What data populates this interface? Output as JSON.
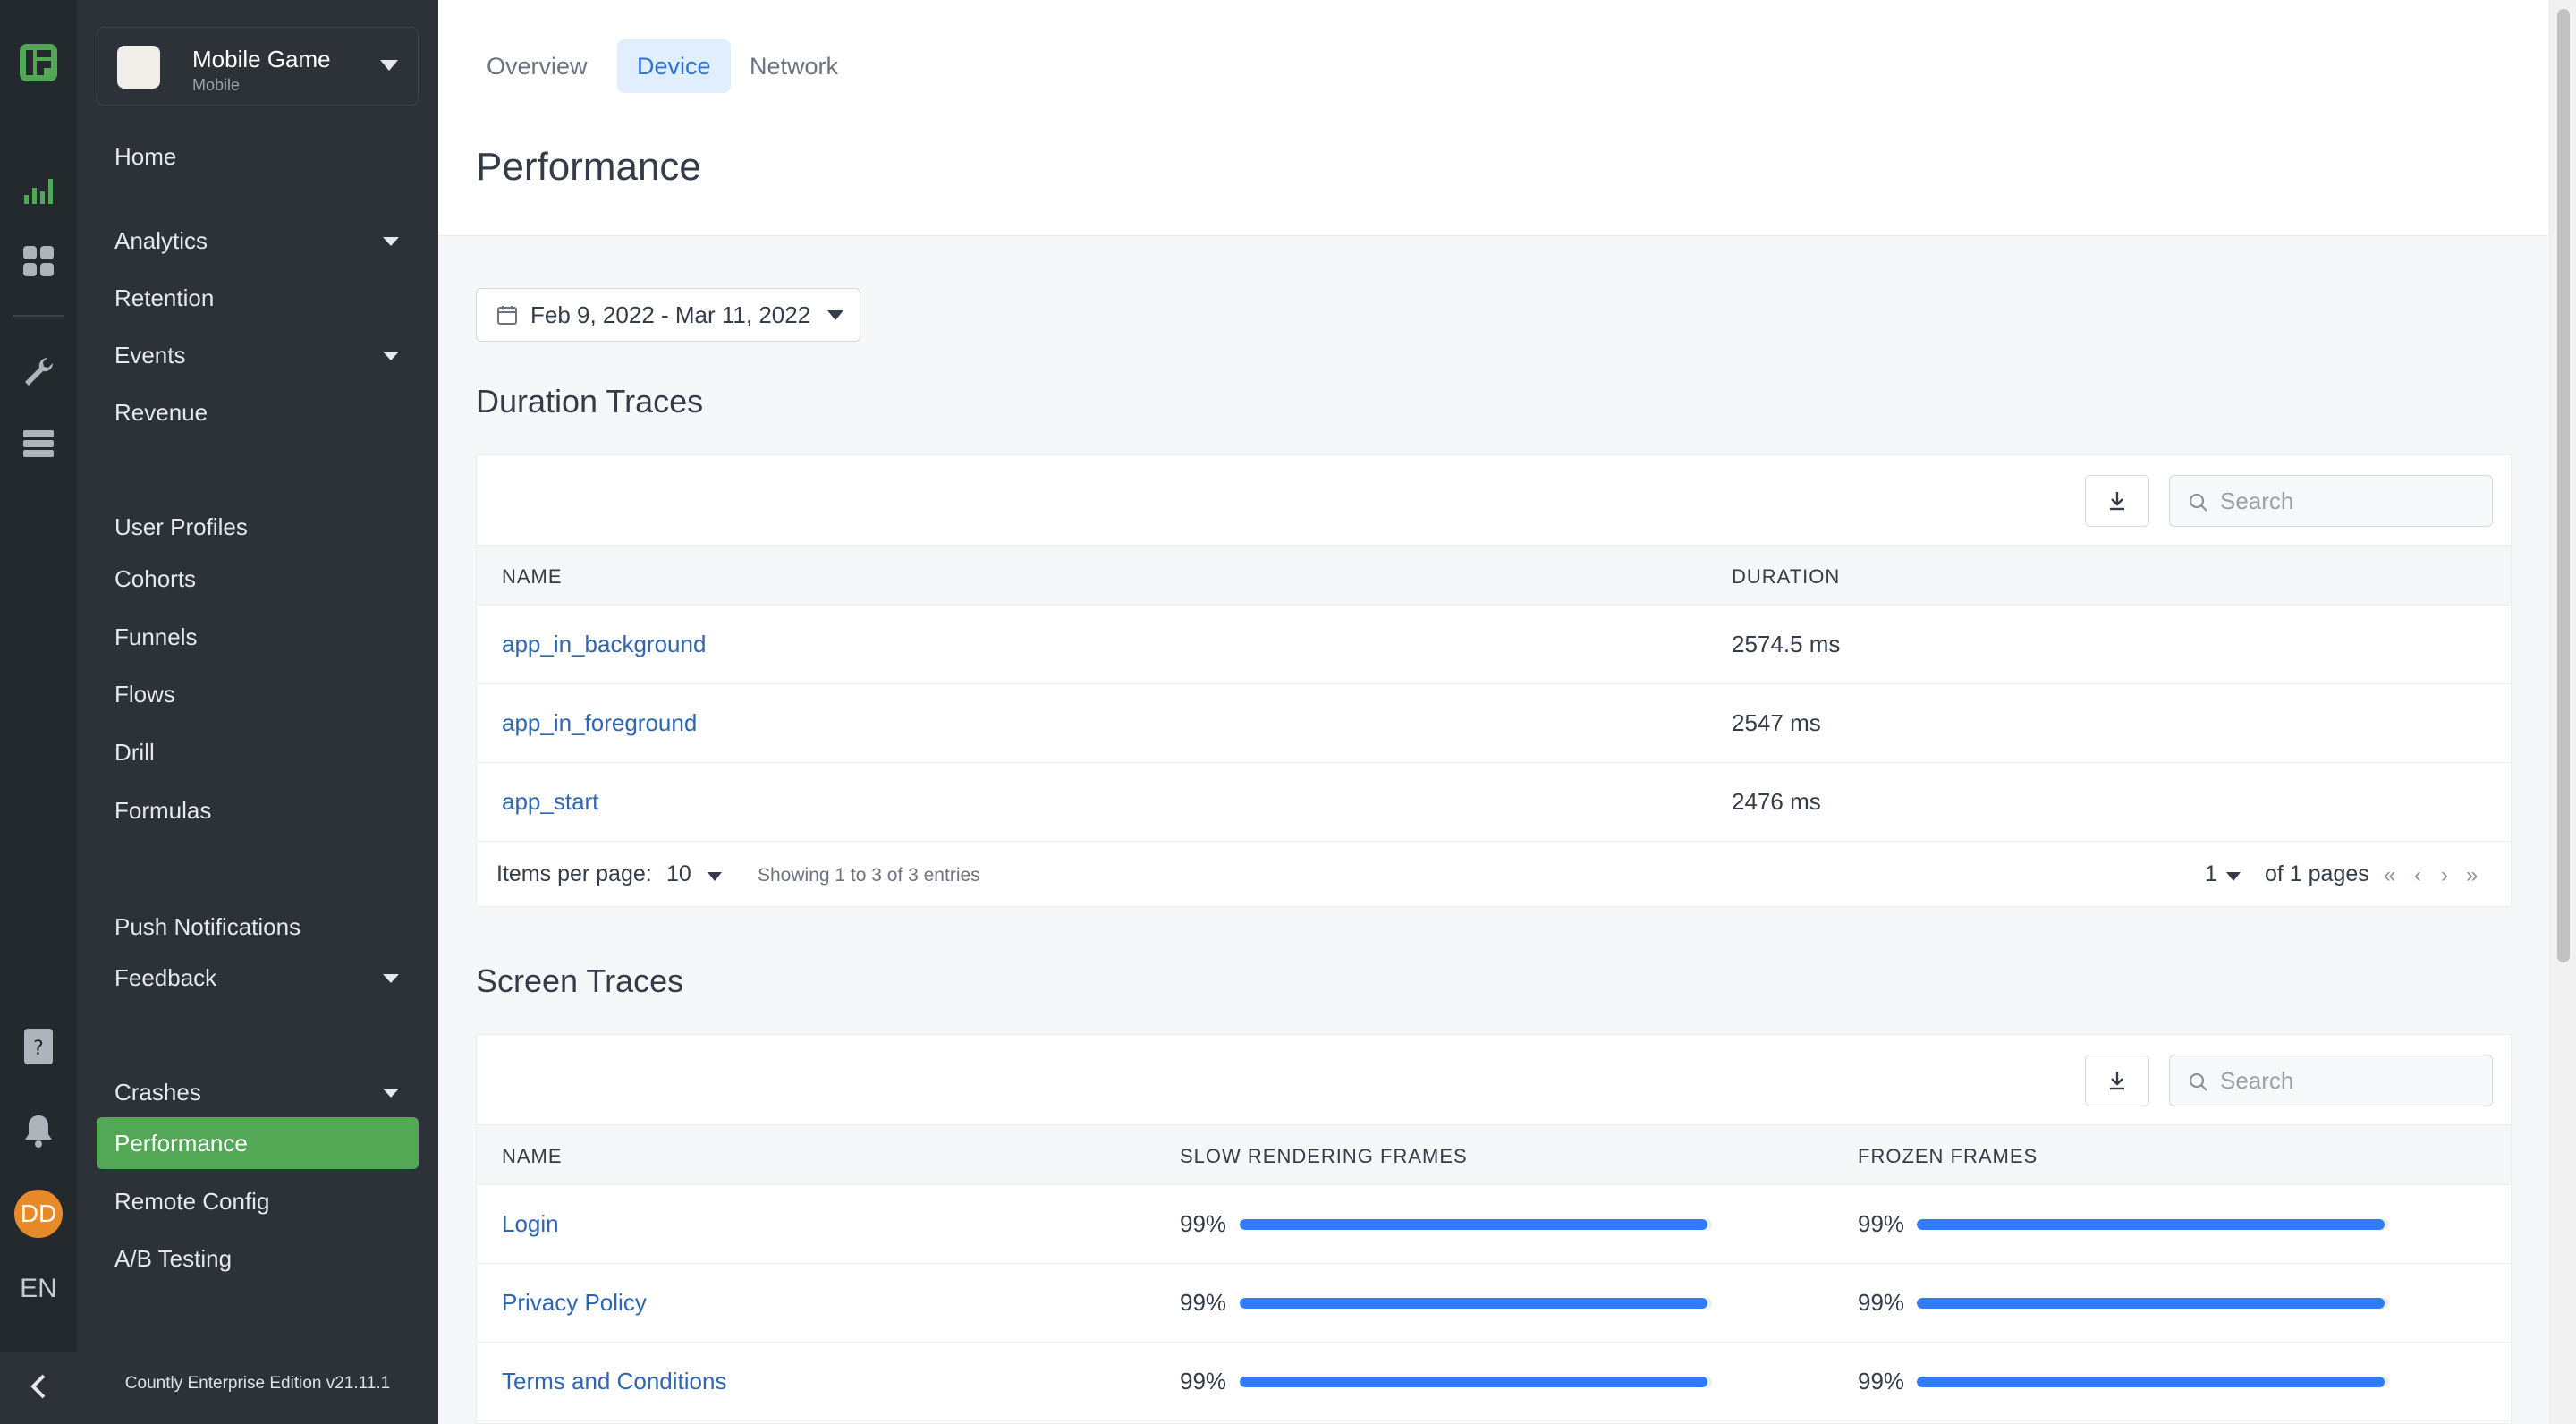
{
  "app": {
    "name": "Mobile Game",
    "type": "Mobile"
  },
  "user": {
    "initials": "DD",
    "language": "EN"
  },
  "sidebar": {
    "items": [
      {
        "label": "Home"
      },
      {
        "label": "Analytics"
      },
      {
        "label": "Retention"
      },
      {
        "label": "Events"
      },
      {
        "label": "Revenue"
      },
      {
        "label": "User Profiles"
      },
      {
        "label": "Cohorts"
      },
      {
        "label": "Funnels"
      },
      {
        "label": "Flows"
      },
      {
        "label": "Drill"
      },
      {
        "label": "Formulas"
      },
      {
        "label": "Push Notifications"
      },
      {
        "label": "Feedback"
      },
      {
        "label": "Crashes"
      },
      {
        "label": "Performance"
      },
      {
        "label": "Remote Config"
      },
      {
        "label": "A/B Testing"
      }
    ],
    "version": "Countly Enterprise Edition v21.11.1"
  },
  "tabs": [
    {
      "label": "Overview"
    },
    {
      "label": "Device"
    },
    {
      "label": "Network"
    }
  ],
  "page_title": "Performance",
  "date_range": "Feb 9, 2022 - Mar 11, 2022",
  "duration_traces": {
    "title": "Duration Traces",
    "search_placeholder": "Search",
    "columns": [
      "NAME",
      "DURATION"
    ],
    "rows": [
      {
        "name": "app_in_background",
        "duration": "2574.5 ms"
      },
      {
        "name": "app_in_foreground",
        "duration": "2547 ms"
      },
      {
        "name": "app_start",
        "duration": "2476 ms"
      }
    ],
    "items_per_page_label": "Items per page:",
    "items_per_page": "10",
    "showing": "Showing 1 to 3 of 3 entries",
    "page": "1",
    "page_total": "of 1 pages"
  },
  "screen_traces": {
    "title": "Screen Traces",
    "search_placeholder": "Search",
    "columns": [
      "NAME",
      "SLOW RENDERING FRAMES",
      "FROZEN FRAMES"
    ],
    "rows": [
      {
        "name": "Login",
        "slow": "99%",
        "slow_fraction": 0.99,
        "frozen": "99%",
        "frozen_fraction": 0.99
      },
      {
        "name": "Privacy Policy",
        "slow": "99%",
        "slow_fraction": 0.99,
        "frozen": "99%",
        "frozen_fraction": 0.99
      },
      {
        "name": "Terms and Conditions",
        "slow": "99%",
        "slow_fraction": 0.99,
        "frozen": "99%",
        "frozen_fraction": 0.99
      }
    ]
  },
  "colors": {
    "accent_green": "#53a855",
    "link_blue": "#2f66b4",
    "bar_blue": "#2f7cf6",
    "avatar_orange": "#e98a2a"
  },
  "icons": [
    "countly-logo-icon",
    "analytics-chart-icon",
    "dashboard-grid-icon",
    "wrench-icon",
    "server-icon",
    "help-book-icon",
    "bell-icon",
    "collapse-chevron-icon",
    "calendar-icon",
    "download-icon",
    "search-icon"
  ]
}
